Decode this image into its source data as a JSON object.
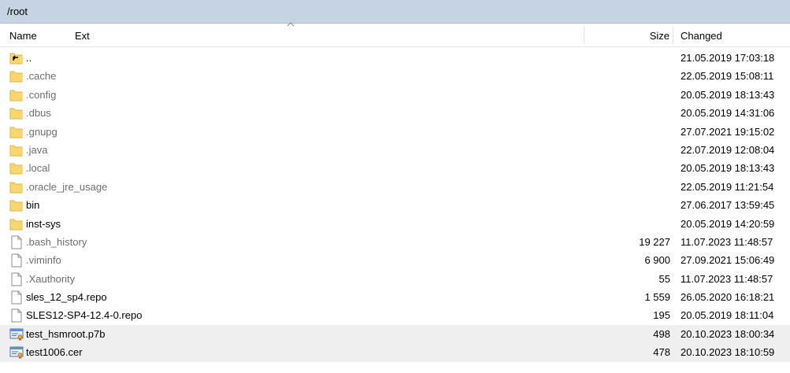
{
  "path": "/root",
  "columns": {
    "name": "Name",
    "ext": "Ext",
    "size": "Size",
    "changed": "Changed"
  },
  "rows": [
    {
      "name": "..",
      "size": "",
      "changed": "21.05.2019 17:03:18",
      "icon": "parent-folder-icon",
      "dim": false,
      "selected": false
    },
    {
      "name": ".cache",
      "size": "",
      "changed": "22.05.2019 15:08:11",
      "icon": "folder-icon",
      "dim": true,
      "selected": false
    },
    {
      "name": ".config",
      "size": "",
      "changed": "20.05.2019 18:13:43",
      "icon": "folder-icon",
      "dim": true,
      "selected": false
    },
    {
      "name": ".dbus",
      "size": "",
      "changed": "20.05.2019 14:31:06",
      "icon": "folder-icon",
      "dim": true,
      "selected": false
    },
    {
      "name": ".gnupg",
      "size": "",
      "changed": "27.07.2021 19:15:02",
      "icon": "folder-icon",
      "dim": true,
      "selected": false
    },
    {
      "name": ".java",
      "size": "",
      "changed": "22.07.2019 12:08:04",
      "icon": "folder-icon",
      "dim": true,
      "selected": false
    },
    {
      "name": ".local",
      "size": "",
      "changed": "20.05.2019 18:13:43",
      "icon": "folder-icon",
      "dim": true,
      "selected": false
    },
    {
      "name": ".oracle_jre_usage",
      "size": "",
      "changed": "22.05.2019 11:21:54",
      "icon": "folder-icon",
      "dim": true,
      "selected": false
    },
    {
      "name": "bin",
      "size": "",
      "changed": "27.06.2017 13:59:45",
      "icon": "folder-icon",
      "dim": false,
      "selected": false
    },
    {
      "name": "inst-sys",
      "size": "",
      "changed": "20.05.2019 14:20:59",
      "icon": "folder-icon",
      "dim": false,
      "selected": false
    },
    {
      "name": ".bash_history",
      "size": "19 227",
      "changed": "11.07.2023 11:48:57",
      "icon": "file-icon",
      "dim": true,
      "selected": false
    },
    {
      "name": ".viminfo",
      "size": "6 900",
      "changed": "27.09.2021 15:06:49",
      "icon": "file-icon",
      "dim": true,
      "selected": false
    },
    {
      "name": ".Xauthority",
      "size": "55",
      "changed": "11.07.2023 11:48:57",
      "icon": "file-icon",
      "dim": true,
      "selected": false
    },
    {
      "name": "sles_12_sp4.repo",
      "size": "1 559",
      "changed": "26.05.2020 16:18:21",
      "icon": "file-icon",
      "dim": false,
      "selected": false
    },
    {
      "name": "SLES12-SP4-12.4-0.repo",
      "size": "195",
      "changed": "20.05.2019 18:11:04",
      "icon": "file-icon",
      "dim": false,
      "selected": false
    },
    {
      "name": "test_hsmroot.p7b",
      "size": "498",
      "changed": "20.10.2023 18:00:34",
      "icon": "certificate-icon",
      "dim": false,
      "selected": true
    },
    {
      "name": "test1006.cer",
      "size": "478",
      "changed": "20.10.2023 18:10:59",
      "icon": "certificate-icon",
      "dim": false,
      "selected": true
    }
  ]
}
